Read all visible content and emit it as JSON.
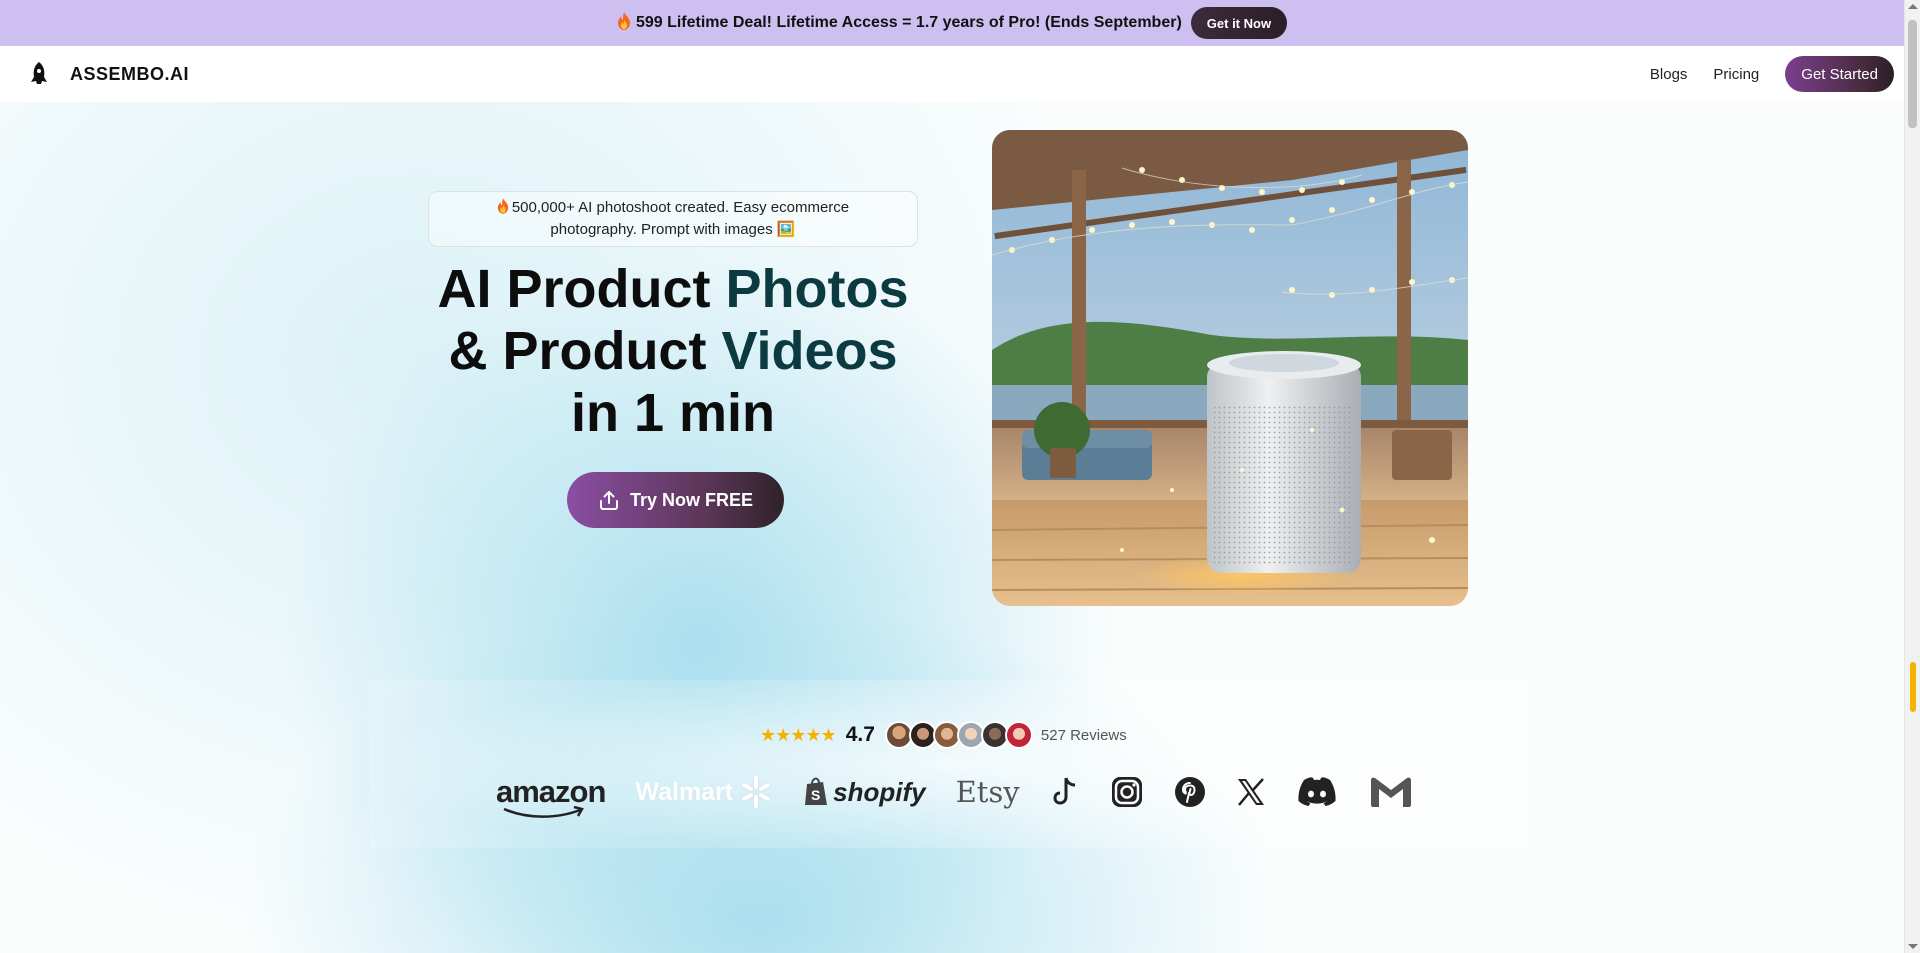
{
  "promo": {
    "text": "599 Lifetime Deal! Lifetime Access = 1.7 years of Pro! (Ends September)",
    "fire_icon": "fire-icon",
    "button_label": "Get it Now"
  },
  "nav": {
    "logo_text": "ASSEMBO.AI",
    "logo_icon": "rocket-icon",
    "links": [
      "Blogs",
      "Pricing"
    ],
    "cta_label": "Get Started"
  },
  "hero": {
    "stat_text": "500,000+ AI photoshoot created. Easy ecommerce photography. Prompt with images 🖼️",
    "stat_icon": "fire-icon",
    "headline": {
      "part1": "AI Product ",
      "accent1": "Photos",
      "part2": "& Product ",
      "accent2": "Videos",
      "part3": "in 1 min"
    },
    "try_button_label": "Try Now FREE",
    "try_button_icon": "upload-icon",
    "image_description_icon": "product-photo-image"
  },
  "social_proof": {
    "stars": "★★★★★",
    "rating": "4.7",
    "reviews": "527 Reviews",
    "avatar_count": 6
  },
  "brands": {
    "amazon": "amazon",
    "walmart": "Walmart",
    "shopify": "shopify",
    "etsy": "Etsy",
    "icons": [
      "tiktok-icon",
      "instagram-icon",
      "pinterest-icon",
      "x-icon",
      "discord-icon",
      "gmail-icon"
    ]
  },
  "colors": {
    "promo_bg": "#cdbff0",
    "cta_gradient_start": "#8a4fa3",
    "accent_text": "#0b3b40",
    "star": "#f5b301"
  }
}
